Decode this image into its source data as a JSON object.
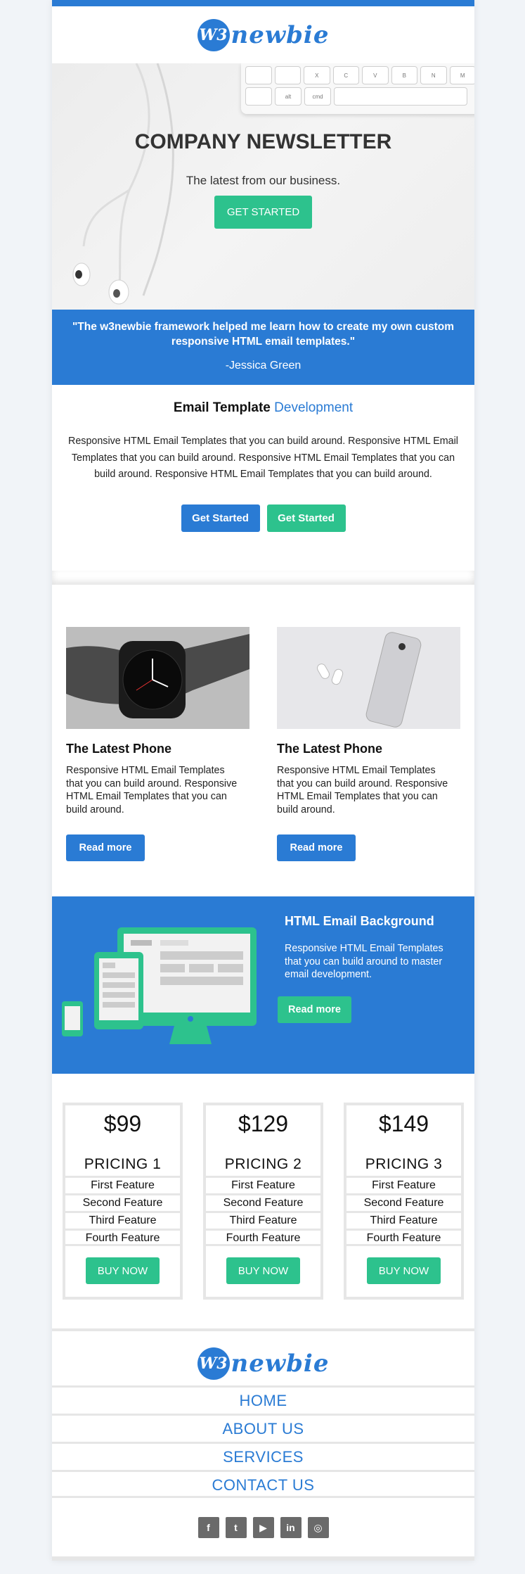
{
  "brand": {
    "logo_badge": "W3",
    "logo_text": "newbie",
    "primary_color": "#2a7bd4",
    "accent_color": "#2dc28d"
  },
  "hero": {
    "title": "COMPANY NEWSLETTER",
    "subtitle": "The latest from our business.",
    "button": "GET STARTED",
    "keyboard_keys_row1": [
      "",
      "",
      "X",
      "C",
      "V",
      "B",
      "N",
      "M"
    ],
    "keyboard_keys_row2": [
      "alt",
      "cmd"
    ]
  },
  "quote": {
    "text": "\"The w3newbie framework helped me learn how to create my own custom responsive HTML email templates.\"",
    "author": "-Jessica Green"
  },
  "intro": {
    "title": "Email Template",
    "title_accent": "Development",
    "body": "Responsive HTML Email Templates that you can build around. Responsive HTML Email Templates that you can build around. Responsive HTML Email Templates that you can build around. Responsive HTML Email Templates that you can build around.",
    "button_primary": "Get Started",
    "button_secondary": "Get Started"
  },
  "products": [
    {
      "title": "The Latest Phone",
      "body": "Responsive HTML Email Templates that you can build around. Responsive HTML Email Templates that you can build around.",
      "button": "Read more"
    },
    {
      "title": "The Latest Phone",
      "body": "Responsive HTML Email Templates that you can build around. Responsive HTML Email Templates that you can build around.",
      "button": "Read more"
    }
  ],
  "feature_block": {
    "title": "HTML Email Background",
    "body": "Responsive HTML Email Templates that you can build around to master email development.",
    "button": "Read more"
  },
  "pricing": [
    {
      "amount": "$99",
      "name": "PRICING 1",
      "features": [
        "First Feature",
        "Second Feature",
        "Third Feature",
        "Fourth Feature"
      ],
      "button": "BUY NOW"
    },
    {
      "amount": "$129",
      "name": "PRICING 2",
      "features": [
        "First Feature",
        "Second Feature",
        "Third Feature",
        "Fourth Feature"
      ],
      "button": "BUY NOW"
    },
    {
      "amount": "$149",
      "name": "PRICING 3",
      "features": [
        "First Feature",
        "Second Feature",
        "Third Feature",
        "Fourth Feature"
      ],
      "button": "BUY NOW"
    }
  ],
  "footer": {
    "nav": [
      "HOME",
      "ABOUT US",
      "SERVICES",
      "CONTACT US"
    ],
    "social": [
      {
        "icon": "facebook-icon",
        "glyph": "f"
      },
      {
        "icon": "twitter-icon",
        "glyph": "t"
      },
      {
        "icon": "youtube-icon",
        "glyph": "▶"
      },
      {
        "icon": "linkedin-icon",
        "glyph": "in"
      },
      {
        "icon": "instagram-icon",
        "glyph": "◎"
      }
    ]
  }
}
